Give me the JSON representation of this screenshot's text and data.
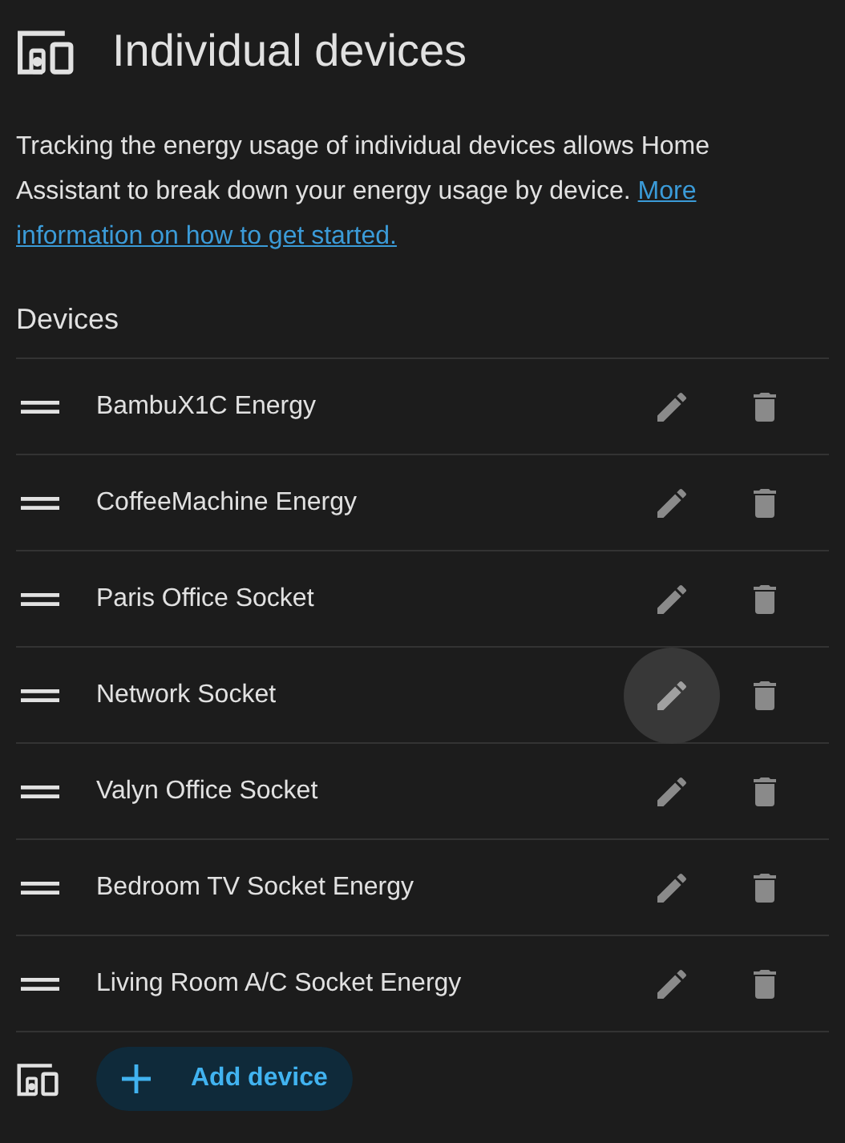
{
  "title": "Individual devices",
  "description": "Tracking the energy usage of individual devices allows Home Assistant to break down your energy usage by device.",
  "link_lines": [
    "More",
    "information on how to get started."
  ],
  "section_label": "Devices",
  "devices": [
    {
      "name": "BambuX1C Energy",
      "hovered": false
    },
    {
      "name": "CoffeeMachine Energy",
      "hovered": false
    },
    {
      "name": "Paris Office Socket",
      "hovered": false
    },
    {
      "name": "Network Socket",
      "hovered": true
    },
    {
      "name": "Valyn Office Socket",
      "hovered": false
    },
    {
      "name": "Bedroom TV Socket Energy",
      "hovered": false
    },
    {
      "name": "Living Room A/C Socket Energy",
      "hovered": false
    }
  ],
  "add_button": "Add device"
}
